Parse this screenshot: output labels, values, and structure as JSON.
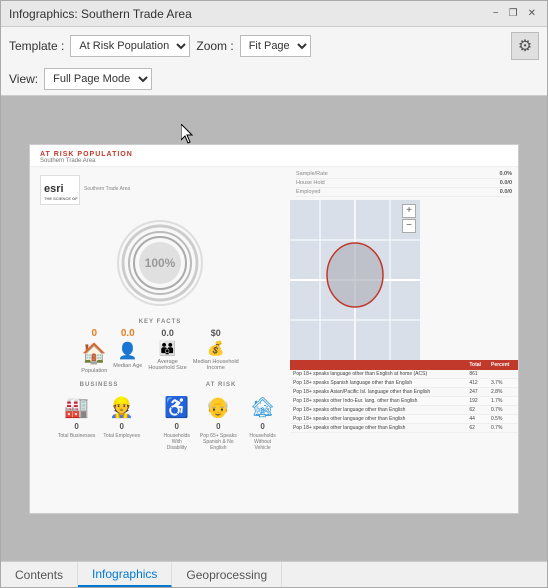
{
  "window": {
    "title": "Infographics: Southern Trade Area"
  },
  "title_bar": {
    "title": "Infographics: Southern Trade Area",
    "minimize_label": "−",
    "restore_label": "❐",
    "close_label": "✕"
  },
  "toolbar": {
    "template_label": "Template :",
    "template_value": "At Risk Population",
    "zoom_label": "Zoom :",
    "zoom_value": "Fit Page",
    "view_label": "View:",
    "view_value": "Full Page Mode",
    "gear_icon": "⚙"
  },
  "infographic": {
    "at_risk_label": "AT RISK POPULATION",
    "subtitle": "Southern Trade Area",
    "subtitle2": "Southern Trade Area",
    "donut_percent": "100%",
    "key_facts_label": "KEY FACTS",
    "facts": [
      {
        "number": "0",
        "label": "Population"
      },
      {
        "number": "0.0",
        "label": "Median Age"
      },
      {
        "number": "0.0",
        "label": "Average Household Size"
      },
      {
        "number": "$0",
        "label": "Median Household Income"
      }
    ],
    "business_label": "BUSINESS",
    "at_risk_section_label": "AT RISK",
    "business_items": [
      {
        "number": "0",
        "label": "Total Businesses"
      },
      {
        "number": "0",
        "label": "Total Employees"
      }
    ],
    "at_risk_items": [
      {
        "number": "0",
        "label": "Households With Disability"
      },
      {
        "number": "0",
        "label": "Pop 65+ Speaks Spanish & No English"
      },
      {
        "number": "0",
        "label": "Households Without Vehicle"
      }
    ],
    "stats": [
      {
        "label": "Sample/Rate",
        "value": "0.0%"
      },
      {
        "label": "House Hold",
        "value": "0.0/0"
      },
      {
        "label": "Employed",
        "value": "0.0/0"
      }
    ],
    "table_headers": [
      "",
      "Total",
      "Percent"
    ],
    "table_rows": [
      [
        "Pop 18+ speaks language other than English at home (ACS)",
        "861",
        ""
      ],
      [
        "Pop 18+ speaks Spanish language other than English",
        "412",
        "3.7%"
      ],
      [
        "Pop 18+ speaks Asian/Pacific Isl. language other than English",
        "247",
        "2.8%"
      ],
      [
        "Pop 18+ speaks other Indo-Eur. lang. other than English",
        "192",
        "1.7%"
      ],
      [
        "Pop 18+ speaks other language other than English",
        "62",
        "0.7%"
      ],
      [
        "Pop 18+ speaks other language other than English",
        "44",
        "0.5%"
      ],
      [
        "Pop 18+ speaks other language other than English",
        "62",
        "0.7%"
      ]
    ],
    "esri_label": "esri",
    "esri_tagline": "THE SCIENCE OF WHERE"
  },
  "tabs": [
    {
      "label": "Contents",
      "active": false
    },
    {
      "label": "Infographics",
      "active": true
    },
    {
      "label": "Geoprocessing",
      "active": false
    }
  ]
}
